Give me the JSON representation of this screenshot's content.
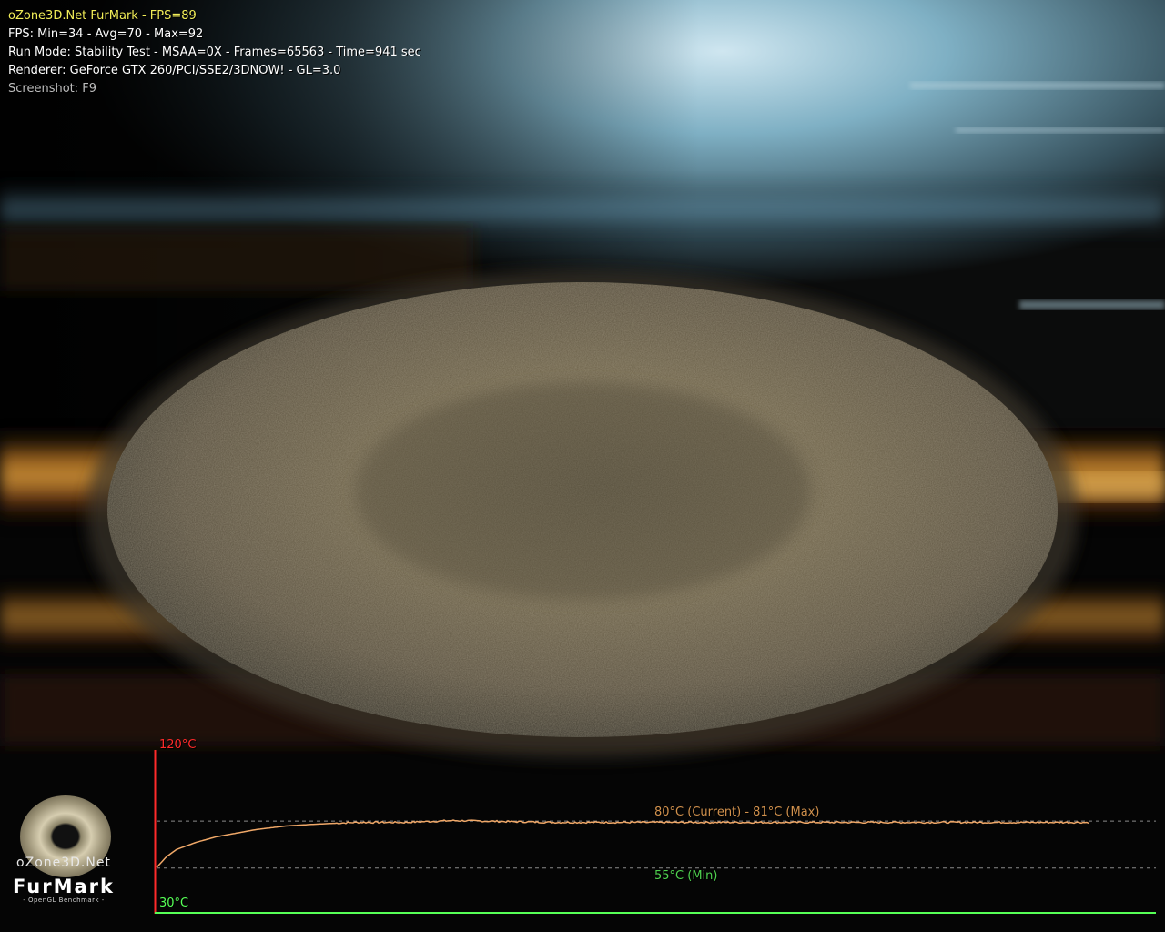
{
  "hud": {
    "title": "oZone3D.Net FurMark - FPS=89",
    "fps_line": "FPS: Min=34 - Avg=70 - Max=92",
    "run_mode_line": "Run Mode: Stability Test - MSAA=0X - Frames=65563 - Time=941 sec",
    "renderer_line": "Renderer: GeForce GTX 260/PCI/SSE2/3DNOW! - GL=3.0",
    "screenshot_hint": "Screenshot: F9"
  },
  "logo": {
    "brand": "oZone3D.Net",
    "product": "FurMark",
    "subtitle": "- OpenGL Benchmark -"
  },
  "temperature_graph": {
    "axis_max_label": "120°C",
    "axis_min_label": "30°C",
    "current_label": "80°C (Current) - 81°C (Max)",
    "min_label": "55°C (Min)",
    "axis_max": 120,
    "axis_min": 30,
    "current": 80,
    "max": 81,
    "min": 55,
    "colors": {
      "axis_max": "#ff2a2a",
      "axis_min": "#56ff56",
      "curve": "#f0a868",
      "current_text": "#d0904c",
      "min_text": "#4fd24f",
      "dashed": "#8a8a8a"
    }
  },
  "chart_data": {
    "type": "line",
    "title": "",
    "xlabel": "",
    "ylabel": "",
    "ylim": [
      30,
      120
    ],
    "series": [
      {
        "x": [
          0,
          10,
          20,
          40,
          60,
          80,
          100,
          130,
          160,
          200,
          250,
          300,
          400,
          500,
          600,
          700,
          800,
          941
        ],
        "values": [
          55,
          61,
          65,
          69,
          72,
          74,
          76,
          78,
          79,
          80,
          80,
          81,
          80,
          80,
          80,
          80,
          80,
          80
        ]
      }
    ]
  }
}
